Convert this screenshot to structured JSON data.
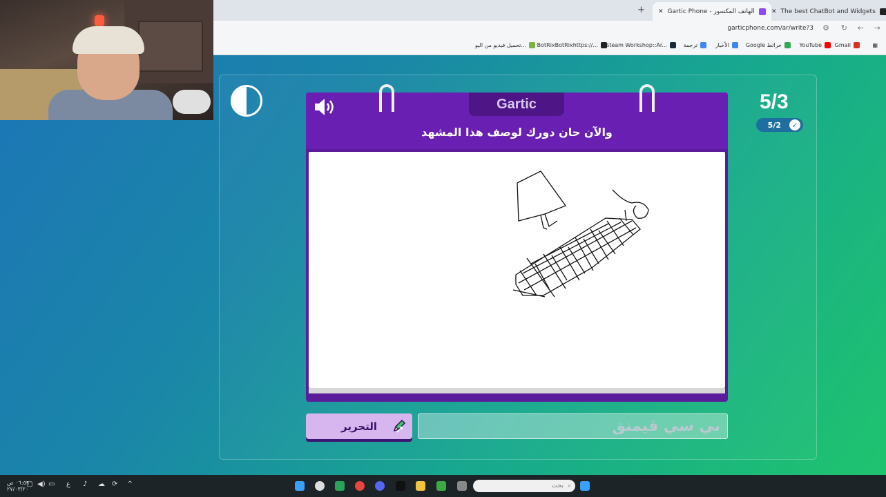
{
  "browser": {
    "tabs": [
      {
        "title": "The best ChatBot and Widgets"
      },
      {
        "title": "Gartic Phone - الهاتف المكسور"
      }
    ],
    "url": "garticphone.com/ar/write?3",
    "bookmarks": [
      {
        "label": "Gmail",
        "color": "#d93025"
      },
      {
        "label": "YouTube",
        "color": "#ff0000"
      },
      {
        "label": "Google خرائط",
        "color": "#34a853"
      },
      {
        "label": "الأخبار",
        "color": "#4285f4"
      },
      {
        "label": "ترجمة",
        "color": "#4285f4"
      },
      {
        "label": "Steam Workshop::Ar...",
        "color": "#1b2838"
      },
      {
        "label": "BotRixBotRixhttps://...",
        "color": "#222222"
      },
      {
        "label": "تحميل فيديو من اليو...",
        "color": "#7cb342"
      }
    ]
  },
  "game": {
    "logo": "Gartic",
    "prompt": "والآن حان دورك لوصف هذا المشهد",
    "round_counter": "5/3",
    "done_badge": "5/2",
    "edit_button": "التحرير",
    "answer_value": "بي سي قيمنق",
    "accent": "#6a1fb3"
  },
  "taskbar": {
    "search_placeholder": "بحث",
    "clock_time": "٠٦:٥٩ ص",
    "clock_date": "٢٧/٠٣/٢٠",
    "lang": "ع"
  }
}
